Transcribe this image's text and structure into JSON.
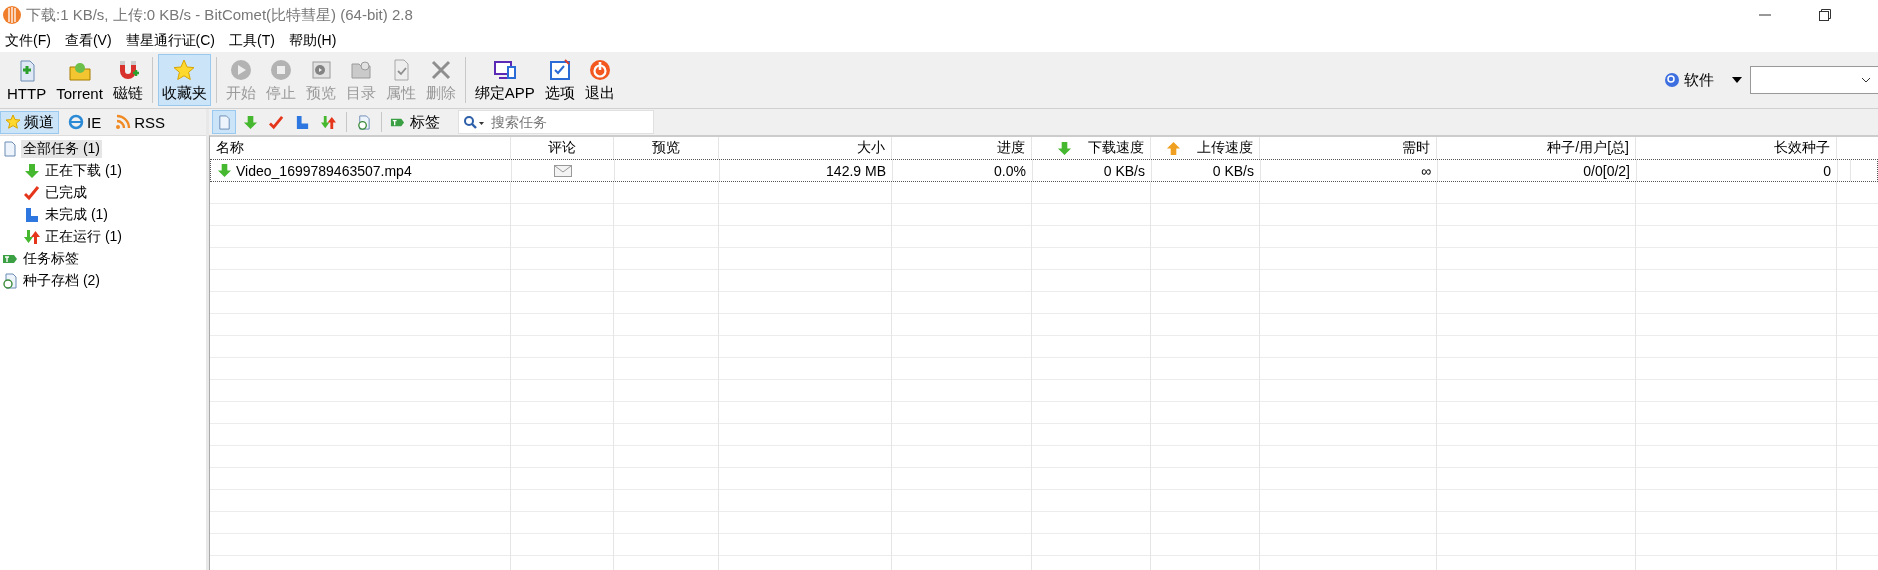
{
  "window": {
    "title": "下载:1 KB/s, 上传:0 KB/s - BitComet(比特彗星) (64-bit) 2.8"
  },
  "menu": [
    "文件(F)",
    "查看(V)",
    "彗星通行证(C)",
    "工具(T)",
    "帮助(H)"
  ],
  "toolbar": [
    {
      "label": "HTTP",
      "selected": false,
      "disabled": false
    },
    {
      "label": "Torrent",
      "selected": false,
      "disabled": false
    },
    {
      "label": "磁链",
      "selected": false,
      "disabled": false
    },
    {
      "label": "收藏夹",
      "selected": true,
      "disabled": false
    },
    {
      "label": "开始",
      "selected": false,
      "disabled": true
    },
    {
      "label": "停止",
      "selected": false,
      "disabled": true
    },
    {
      "label": "预览",
      "selected": false,
      "disabled": true
    },
    {
      "label": "目录",
      "selected": false,
      "disabled": true
    },
    {
      "label": "属性",
      "selected": false,
      "disabled": true
    },
    {
      "label": "删除",
      "selected": false,
      "disabled": true
    },
    {
      "label": "绑定APP",
      "selected": false,
      "disabled": false
    },
    {
      "label": "选项",
      "selected": false,
      "disabled": false
    },
    {
      "label": "退出",
      "selected": false,
      "disabled": false
    }
  ],
  "search_provider": {
    "label": "软件"
  },
  "side_tabs": [
    {
      "label": "频道",
      "selected": true
    },
    {
      "label": "IE",
      "selected": false
    },
    {
      "label": "RSS",
      "selected": false
    }
  ],
  "tree": [
    {
      "label": "全部任务 (1)",
      "selected": true,
      "children": [
        {
          "label": "正在下载 (1)",
          "selected": false
        },
        {
          "label": "已完成",
          "selected": false
        },
        {
          "label": "未完成 (1)",
          "selected": false
        },
        {
          "label": "正在运行 (1)",
          "selected": false
        }
      ]
    },
    {
      "label": "任务标签",
      "selected": false
    },
    {
      "label": "种子存档 (2)",
      "selected": false
    }
  ],
  "filters": [
    {
      "selected": true
    },
    {
      "selected": false
    },
    {
      "selected": false
    },
    {
      "selected": false
    },
    {
      "selected": false
    }
  ],
  "tag_button": {
    "label": "标签"
  },
  "search": {
    "placeholder": "搜索任务"
  },
  "table": {
    "columns": [
      "名称",
      "评论",
      "预览",
      "大小",
      "进度",
      "下载速度",
      "上传速度",
      "需时",
      "种子/用户[总]",
      "长效种子"
    ],
    "rows": [
      {
        "name": "Video_1699789463507.mp4",
        "preview": "",
        "size": "142.9 MB",
        "progress": "0.0%",
        "download_speed": "0 KB/s",
        "upload_speed": "0 KB/s",
        "time_left": "∞",
        "seeds_peers": "0/0[0/2]",
        "long_term_seeds": "0"
      }
    ]
  }
}
